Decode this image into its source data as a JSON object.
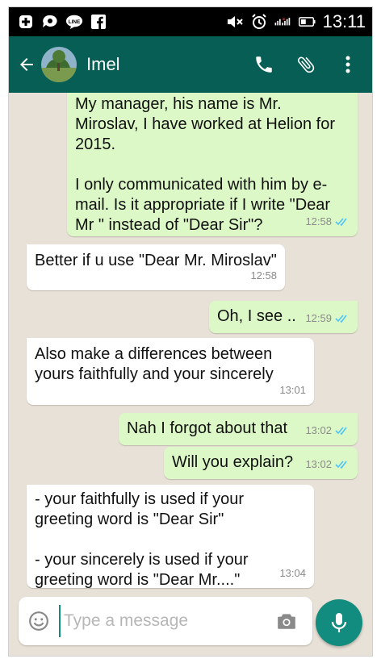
{
  "status_bar": {
    "time": "13:11",
    "left_icons": [
      "bbm-icon",
      "message-sync-icon",
      "line-icon",
      "facebook-icon"
    ],
    "right_icons": [
      "mute-icon",
      "alarm-icon",
      "signal-icon",
      "battery-icon"
    ]
  },
  "header": {
    "contact_name": "Imel",
    "actions": [
      "call-icon",
      "attach-icon",
      "more-icon"
    ]
  },
  "messages": [
    {
      "side": "out",
      "text": "My manager, his name is Mr.\nMiroslav, I have worked at Helion for\n2015.\n\nI only communicated with him by e-\nmail. Is it appropriate if I write \"Dear\nMr \" instead of \"Dear Sir\"?",
      "time": "12:58",
      "read": true
    },
    {
      "side": "in",
      "text": "Better if u use \"Dear Mr. Miroslav\"",
      "time": "12:58"
    },
    {
      "side": "out",
      "text": "Oh, I see ..",
      "time": "12:59",
      "read": true
    },
    {
      "side": "in",
      "text": "Also make a differences between\nyours faithfully and your sincerely",
      "time": "13:01"
    },
    {
      "side": "out",
      "text": "Nah I forgot about that",
      "time": "13:02",
      "read": true
    },
    {
      "side": "out",
      "text": "Will you explain?",
      "time": "13:02",
      "read": true
    },
    {
      "side": "in",
      "text": "- your faithfully is used if your\ngreeting word is \"Dear Sir\"\n\n- your sincerely is used if your\ngreeting word is \"Dear Mr....\"",
      "time": "13:04"
    }
  ],
  "composer": {
    "placeholder": "Type a message"
  },
  "colors": {
    "header": "#075e54",
    "outgoing_bubble": "#dcf8c6",
    "incoming_bubble": "#ffffff",
    "accent": "#128c7e",
    "read_ticks": "#4fc3f7",
    "chat_background": "#e8e1d7"
  }
}
